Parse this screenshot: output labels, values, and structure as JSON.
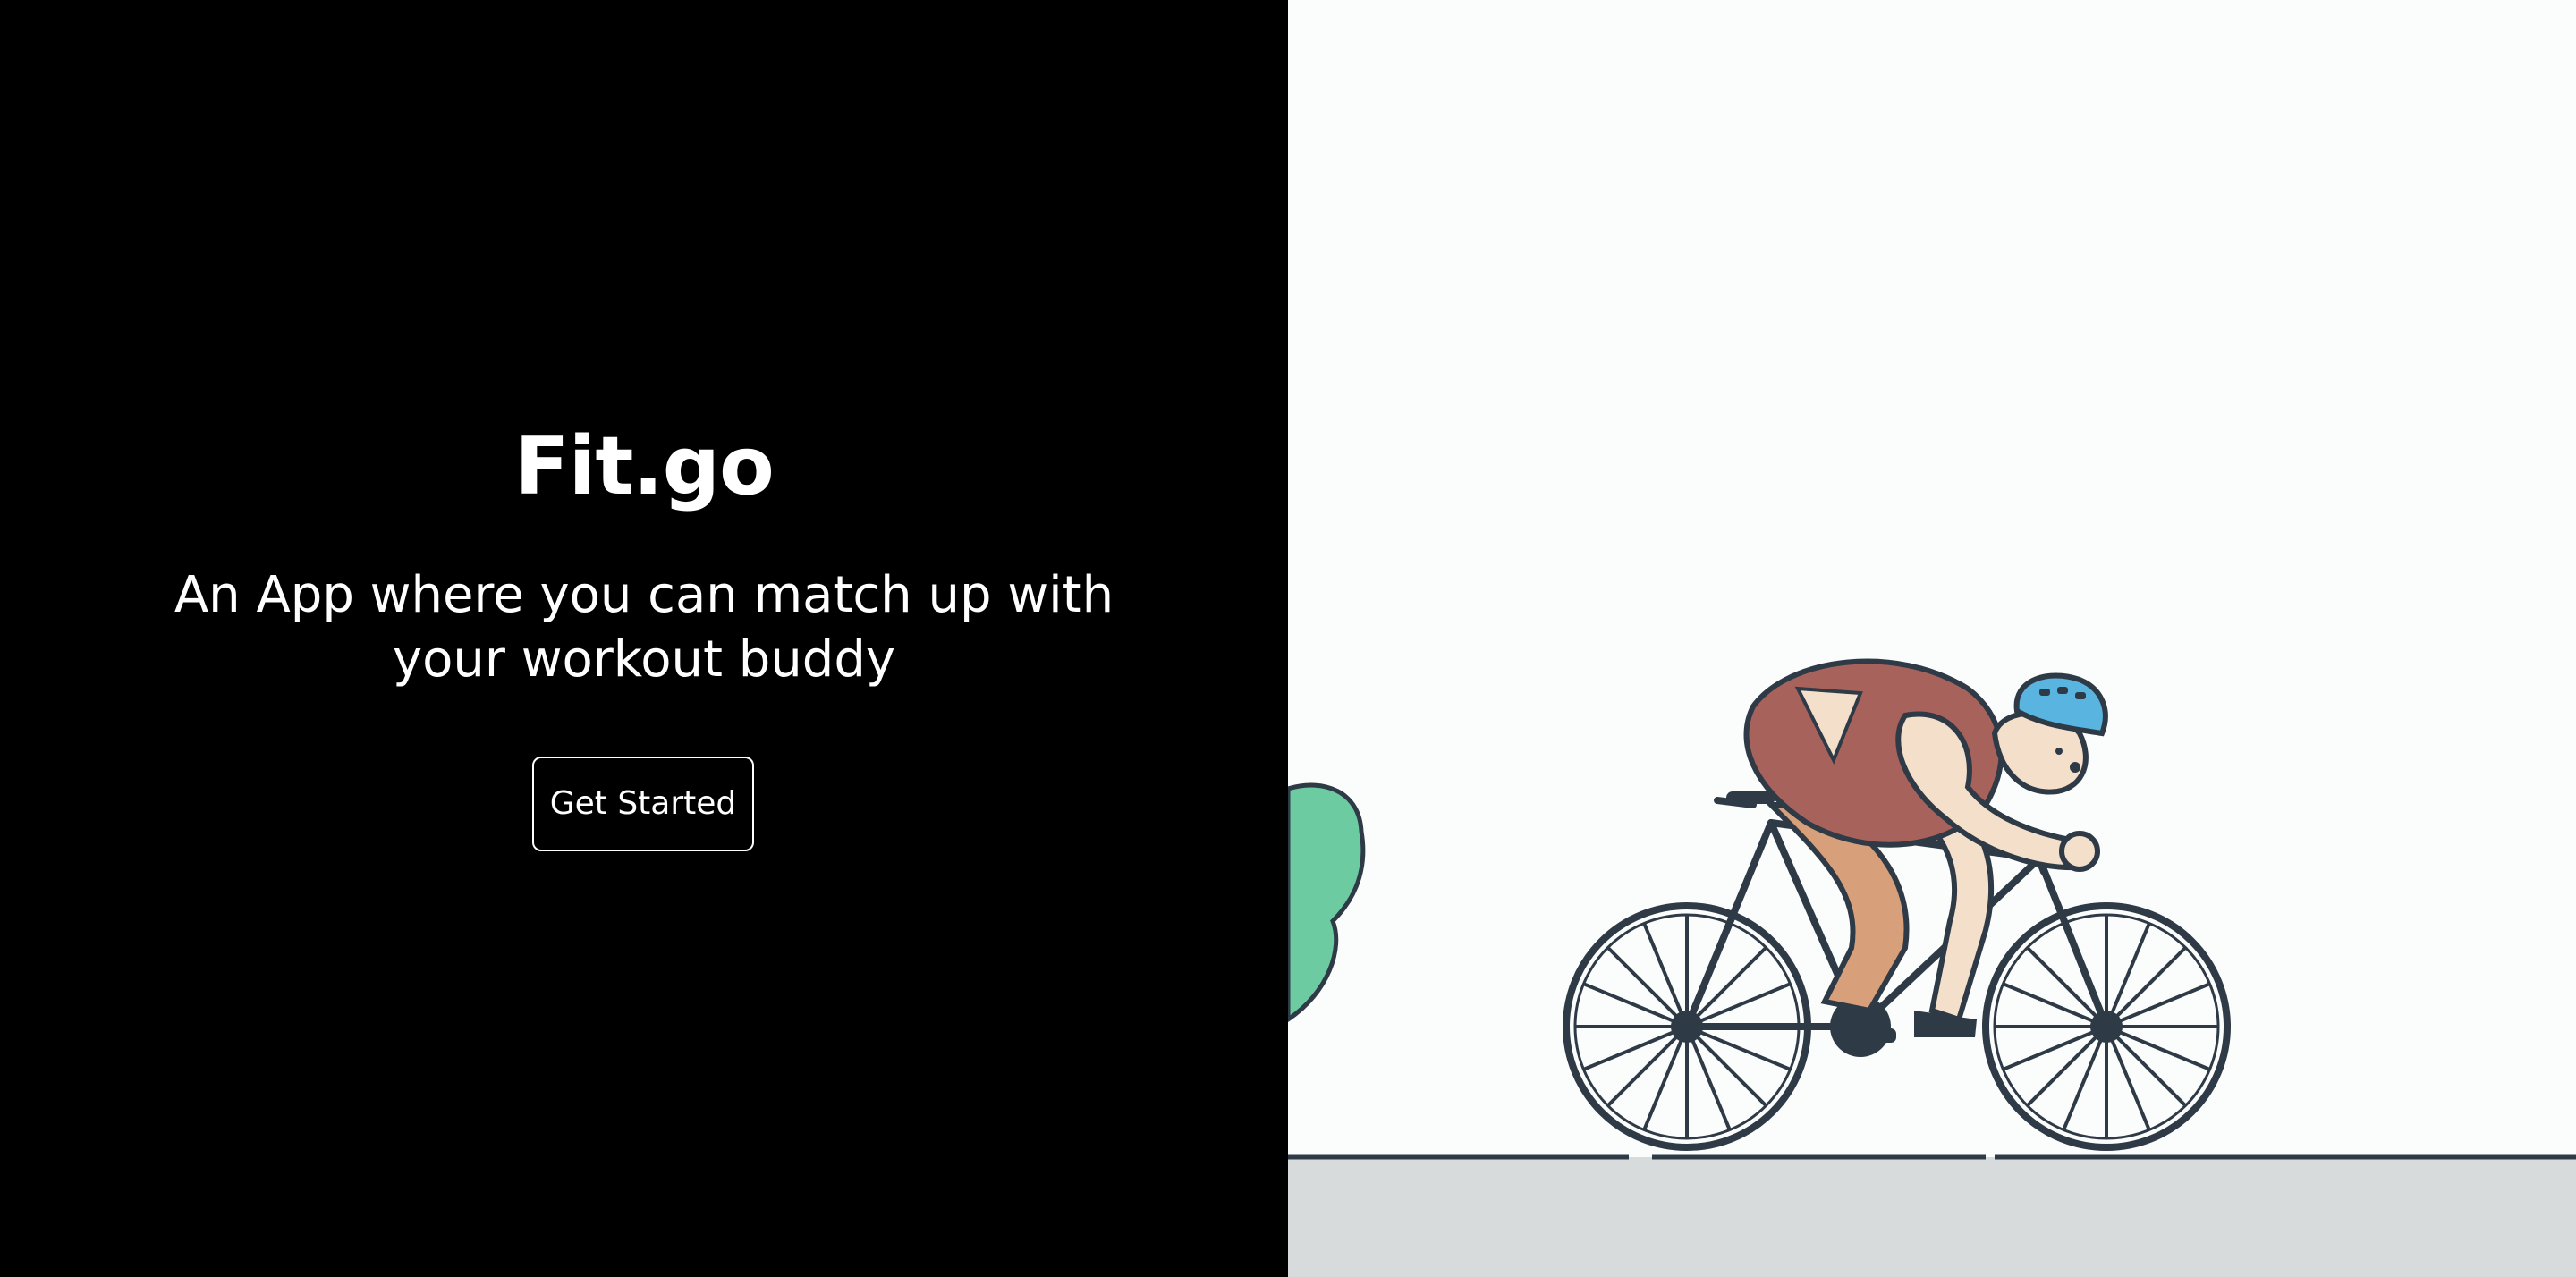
{
  "hero": {
    "title": "Fit.go",
    "tagline": "An App where you can match up with your workout buddy",
    "cta_label": "Get Started"
  },
  "illustration": {
    "subject": "cyclist-riding-bicycle",
    "colors": {
      "outline": "#2f3a47",
      "jersey": "#a8625c",
      "skin": "#f4dfca",
      "helmet": "#5ab4e0",
      "bush": "#6ccba1",
      "ground": "#d7dbdb",
      "background": "#fbfcfc"
    }
  },
  "colors": {
    "left_background": "#000000",
    "text": "#ffffff"
  }
}
